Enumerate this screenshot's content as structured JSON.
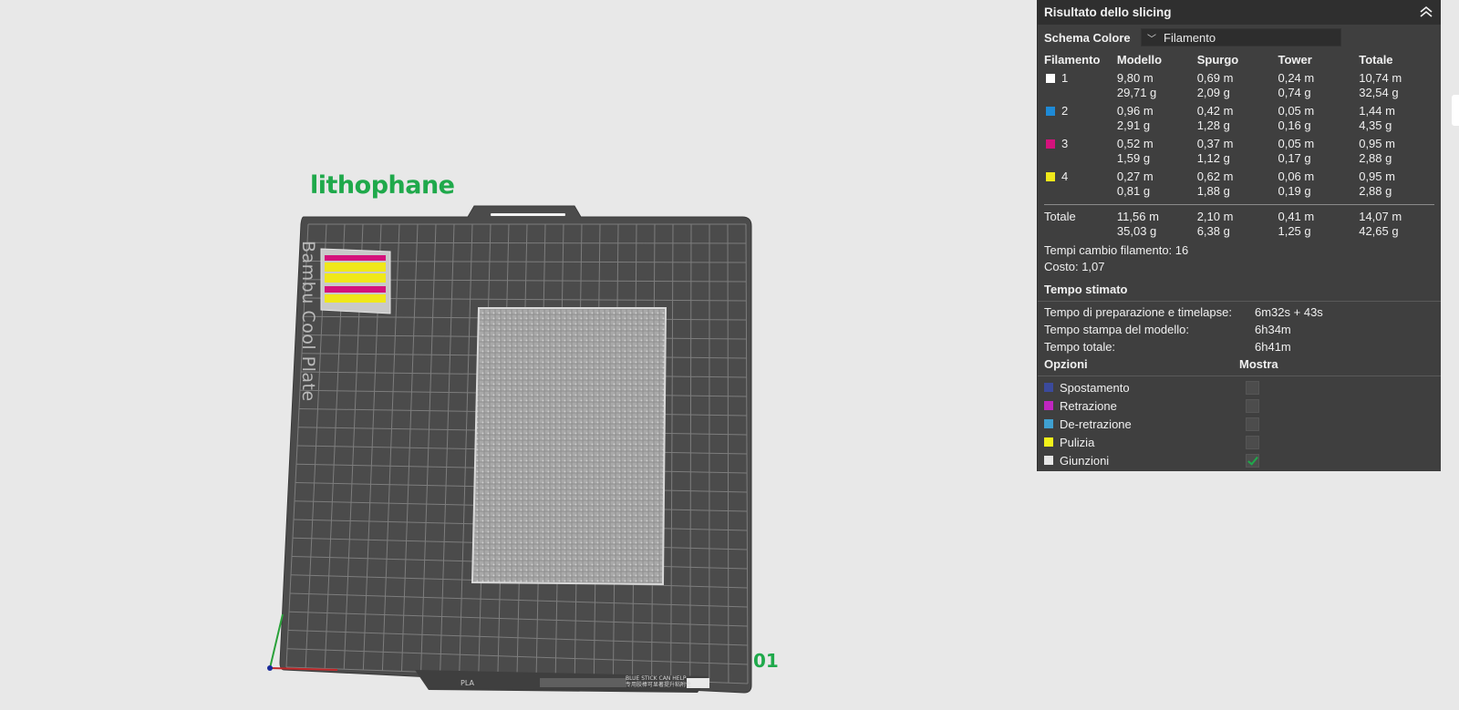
{
  "viewport": {
    "plate_name": "lithophane",
    "plate_number": "01",
    "plate_vertical_label": "Bambu Cool Plate",
    "plate_tag": "PLA",
    "plate_help_line1": "BLUE STICK CAN HELP",
    "plate_help_line2": "专用胶棒可显著提升粘附性"
  },
  "panel": {
    "title": "Risultato dello slicing",
    "collapse_icon": "chevron-double-up-icon",
    "scheme_label": "Schema Colore",
    "scheme_value": "Filamento",
    "columns": [
      "Filamento",
      "Modello",
      "Spurgo",
      "Tower",
      "Totale"
    ],
    "filaments": [
      {
        "id": "1",
        "color": "#ffffff",
        "model_m": "9,80 m",
        "model_g": "29,71 g",
        "purge_m": "0,69 m",
        "purge_g": "2,09 g",
        "tower_m": "0,24 m",
        "tower_g": "0,74 g",
        "total_m": "10,74 m",
        "total_g": "32,54 g"
      },
      {
        "id": "2",
        "color": "#1e8ad6",
        "model_m": "0,96 m",
        "model_g": "2,91 g",
        "purge_m": "0,42 m",
        "purge_g": "1,28 g",
        "tower_m": "0,05 m",
        "tower_g": "0,16 g",
        "total_m": "1,44 m",
        "total_g": "4,35 g"
      },
      {
        "id": "3",
        "color": "#d4127c",
        "model_m": "0,52 m",
        "model_g": "1,59 g",
        "purge_m": "0,37 m",
        "purge_g": "1,12 g",
        "tower_m": "0,05 m",
        "tower_g": "0,17 g",
        "total_m": "0,95 m",
        "total_g": "2,88 g"
      },
      {
        "id": "4",
        "color": "#f0e81a",
        "model_m": "0,27 m",
        "model_g": "0,81 g",
        "purge_m": "0,62 m",
        "purge_g": "1,88 g",
        "tower_m": "0,06 m",
        "tower_g": "0,19 g",
        "total_m": "0,95 m",
        "total_g": "2,88 g"
      }
    ],
    "totals": {
      "label": "Totale",
      "model_m": "11,56 m",
      "model_g": "35,03 g",
      "purge_m": "2,10 m",
      "purge_g": "6,38 g",
      "tower_m": "0,41 m",
      "tower_g": "1,25 g",
      "total_m": "14,07 m",
      "total_g": "42,65 g"
    },
    "changes_label": "Tempi cambio filamento:",
    "changes_value": "16",
    "cost_label": "Costo:",
    "cost_value": "1,07",
    "time_section": "Tempo stimato",
    "times": [
      {
        "label": "Tempo di preparazione e timelapse:",
        "value": "6m32s + 43s"
      },
      {
        "label": "Tempo stampa del modello:",
        "value": "6h34m"
      },
      {
        "label": "Tempo totale:",
        "value": "6h41m"
      }
    ],
    "options_label": "Opzioni",
    "show_label": "Mostra",
    "options": [
      {
        "label": "Spostamento",
        "color": "#3b4a9c",
        "checked": false
      },
      {
        "label": "Retrazione",
        "color": "#c026c0",
        "checked": false
      },
      {
        "label": "De-retrazione",
        "color": "#3fa0d0",
        "checked": false
      },
      {
        "label": "Pulizia",
        "color": "#f2f21a",
        "checked": false
      },
      {
        "label": "Giunzioni",
        "color": "#e6e6e6",
        "checked": true
      }
    ]
  }
}
